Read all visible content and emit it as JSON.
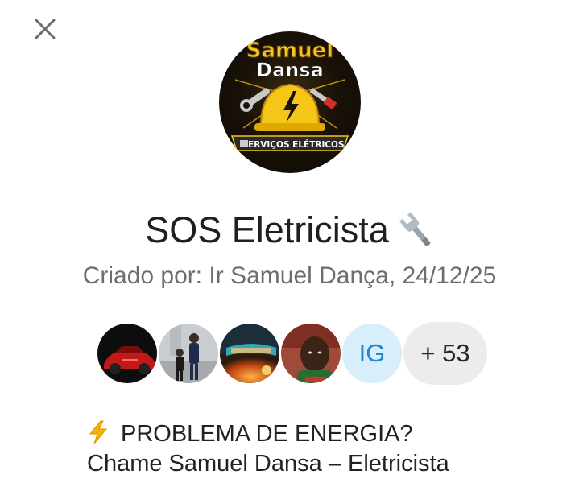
{
  "header": {
    "close_icon": "close-icon"
  },
  "group": {
    "avatar": {
      "logo_line1": "Samuel",
      "logo_line2": "Dansa",
      "logo_banner": "SERVIÇOS ELÉTRICOS"
    },
    "title": "SOS Eletricista",
    "title_icon": "wrench-icon",
    "created_by": "Criado por: Ir Samuel Dança, 24/12/25"
  },
  "members": {
    "photos": [
      "member-photo-red-car",
      "member-photo-two-people",
      "member-photo-daniel-book",
      "member-photo-man"
    ],
    "initials": "IG",
    "more_count": "+ 53"
  },
  "description": {
    "icon": "lightning-icon",
    "line1": "PROBLEMA DE ENERGIA?",
    "line2": "Chame Samuel Dansa – Eletricista"
  },
  "colors": {
    "initials_bg": "#d9eefb",
    "initials_text": "#1f86c9",
    "more_bg": "#ececec",
    "logo_yellow": "#f5c518"
  }
}
